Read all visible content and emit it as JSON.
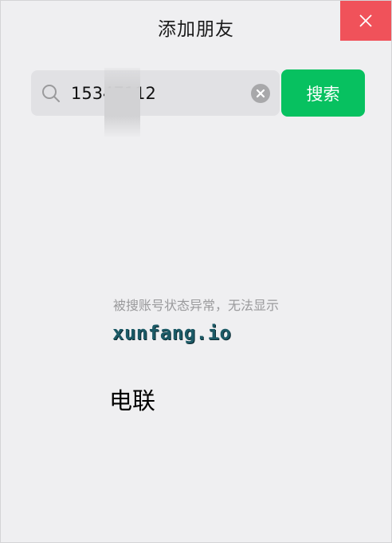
{
  "window": {
    "title": "添加朋友"
  },
  "search": {
    "value": "15347112",
    "button_label": "搜索"
  },
  "result": {
    "status_message": "被搜账号状态异常，无法显示"
  },
  "overlay": {
    "watermark": "xunfang.io",
    "carrier": "电联"
  },
  "colors": {
    "accent": "#07c160",
    "close": "#f0525a",
    "background": "#efeff1",
    "input_bg": "#e1e1e4"
  },
  "icons": {
    "close": "close-icon",
    "search": "search-icon",
    "clear": "clear-icon"
  }
}
